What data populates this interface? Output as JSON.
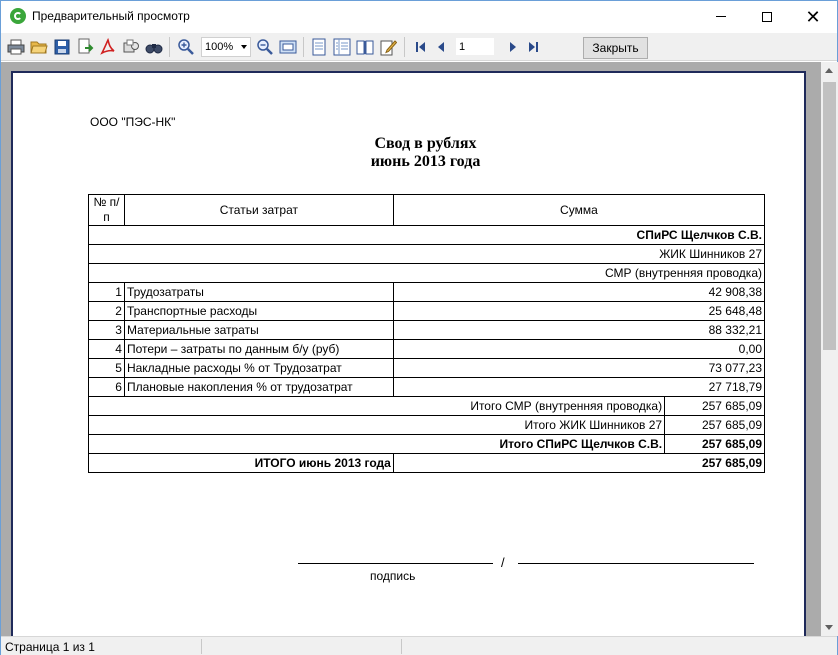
{
  "window": {
    "title": "Предварительный просмотр",
    "close_label": "Закрыть",
    "zoom": "100%",
    "page_number": "1"
  },
  "toolbar": {
    "icons": [
      "print-icon",
      "open-icon",
      "save-icon",
      "export-icon",
      "pdf-icon",
      "email-icon",
      "find-icon",
      "zoom-in-icon",
      "zoom-out-icon",
      "fit-page-icon",
      "single-page-icon",
      "multi-page-icon",
      "book-icon",
      "edit-icon",
      "first-page-icon",
      "prev-page-icon",
      "next-page-icon",
      "last-page-icon"
    ]
  },
  "status": {
    "page_info": "Страница 1 из 1"
  },
  "report": {
    "org": "ООО \"ПЭС-НК\"",
    "title_line1": "Свод в рублях",
    "title_line2": "июнь 2013 года",
    "headers": {
      "num": "№ п/п",
      "item": "Статьи затрат",
      "sum": "Сумма"
    },
    "group1": "СПиРС Щелчков С.В.",
    "group2": "ЖИК Шинников 27",
    "group3": "СМР (внутренняя проводка)",
    "rows": [
      {
        "n": "1",
        "name": "Трудозатраты",
        "sum": "42 908,38"
      },
      {
        "n": "2",
        "name": "Транспортные расходы",
        "sum": "25 648,48"
      },
      {
        "n": "3",
        "name": "Материальные затраты",
        "sum": "88 332,21"
      },
      {
        "n": "4",
        "name": "Потери – затраты по данным б/у (руб)",
        "sum": "0,00"
      },
      {
        "n": "5",
        "name": "Накладные расходы % от Трудозатрат",
        "sum": "73 077,23"
      },
      {
        "n": "6",
        "name": "Плановые накопления % от трудозатрат",
        "sum": "27 718,79"
      }
    ],
    "totals": [
      {
        "label": "Итого СМР (внутренняя проводка)",
        "sum": "257 685,09"
      },
      {
        "label": "Итого ЖИК Шинников 27",
        "sum": "257 685,09"
      },
      {
        "label": "Итого СПиРС Щелчков С.В.",
        "sum": "257 685,09"
      }
    ],
    "grand_total_label": "ИТОГО июнь 2013 года",
    "grand_total_sum": "257 685,09",
    "slash": "/",
    "signature_label": "подпись"
  }
}
